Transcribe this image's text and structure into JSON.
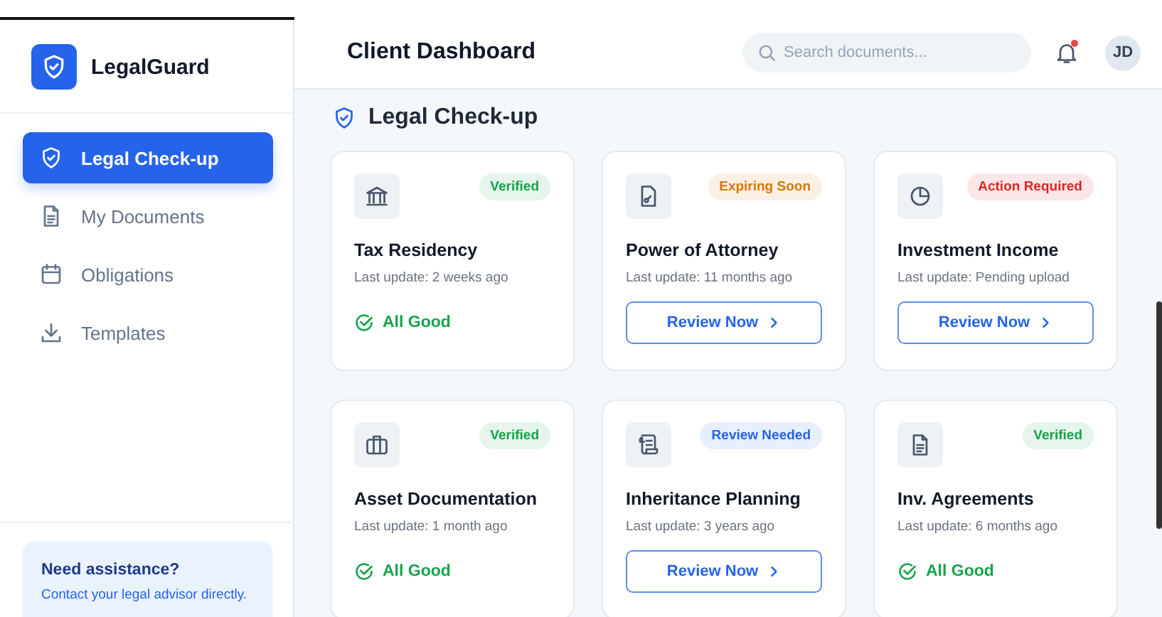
{
  "brand": {
    "name": "LegalGuard"
  },
  "nav": [
    {
      "label": "Legal Check-up",
      "selected": true
    },
    {
      "label": "My Documents",
      "selected": false
    },
    {
      "label": "Obligations",
      "selected": false
    },
    {
      "label": "Templates",
      "selected": false
    }
  ],
  "help": {
    "title": "Need assistance?",
    "text": "Contact your legal advisor directly."
  },
  "header": {
    "title": "Client Dashboard",
    "search": {
      "placeholder": "Search documents..."
    },
    "notifications": {
      "unread": true
    },
    "avatar": "JD"
  },
  "section": {
    "title": "Legal Check-up"
  },
  "cards": [
    {
      "badge": "Verified",
      "color": "#16a34a",
      "title": "Tax Residency",
      "update": "Last update: 2 weeks ago",
      "footer": {
        "kind": "ok",
        "label": "All Good"
      }
    },
    {
      "badge": "Expiring Soon",
      "color": "#d97706",
      "title": "Power of Attorney",
      "update": "Last update: 11 months ago",
      "footer": {
        "kind": "button",
        "label": "Review Now"
      }
    },
    {
      "badge": "Action Required",
      "color": "#dc2626",
      "title": "Investment Income",
      "update": "Last update: Pending upload",
      "footer": {
        "kind": "button",
        "label": "Review Now"
      }
    },
    {
      "badge": "Verified",
      "color": "#16a34a",
      "title": "Asset Documentation",
      "update": "Last update: 1 month ago",
      "footer": {
        "kind": "ok",
        "label": "All Good"
      }
    },
    {
      "badge": "Review Needed",
      "color": "#2563eb",
      "title": "Inheritance Planning",
      "update": "Last update: 3 years ago",
      "footer": {
        "kind": "button",
        "label": "Review Now"
      }
    },
    {
      "badge": "Verified",
      "color": "#16a34a",
      "title": "Inv. Agreements",
      "update": "Last update: 6 months ago",
      "footer": {
        "kind": "ok",
        "label": "All Good"
      }
    }
  ]
}
